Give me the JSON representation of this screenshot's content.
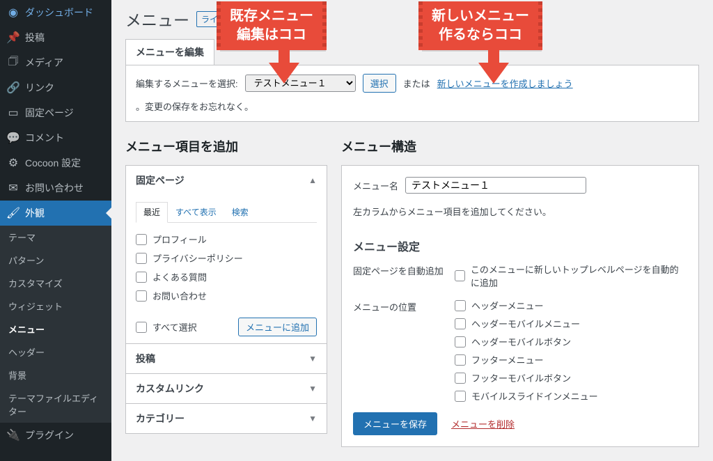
{
  "sidebar": {
    "items": [
      {
        "label": "ダッシュボード",
        "icon": "◉"
      },
      {
        "label": "投稿",
        "icon": "✎"
      },
      {
        "label": "メディア",
        "icon": "❐"
      },
      {
        "label": "リンク",
        "icon": "🔗"
      },
      {
        "label": "固定ページ",
        "icon": "▭"
      },
      {
        "label": "コメント",
        "icon": "💬"
      },
      {
        "label": "Cocoon 設定",
        "icon": "⚙"
      },
      {
        "label": "お問い合わせ",
        "icon": "✉"
      },
      {
        "label": "外観",
        "icon": "🖌"
      },
      {
        "label": "プラグイン",
        "icon": "🔌"
      }
    ],
    "appearance_sub": [
      "テーマ",
      "パターン",
      "カスタマイズ",
      "ウィジェット",
      "メニュー",
      "ヘッダー",
      "背景",
      "テーマファイルエディター"
    ]
  },
  "page": {
    "title": "メニュー",
    "tag": "ライ",
    "tab_edit": "メニューを編集"
  },
  "selector": {
    "label": "編集するメニューを選択:",
    "value": "テストメニュー１",
    "button": "選択",
    "or": "または",
    "create_link": "新しいメニューを作成しましょう",
    "suffix": "。変更の保存をお忘れなく。"
  },
  "callouts": {
    "edit_line1": "既存メニュー",
    "edit_line2": "編集はココ",
    "new_line1": "新しいメニュー",
    "new_line2": "作るならココ"
  },
  "add": {
    "title": "メニュー項目を追加",
    "pages": "固定ページ",
    "subtabs": {
      "recent": "最近",
      "all": "すべて表示",
      "search": "検索"
    },
    "items": [
      "プロフィール",
      "プライバシーポリシー",
      "よくある質問",
      "お問い合わせ"
    ],
    "select_all": "すべて選択",
    "add_btn": "メニューに追加",
    "posts": "投稿",
    "custom": "カスタムリンク",
    "categories": "カテゴリー"
  },
  "struct": {
    "title": "メニュー構造",
    "name_label": "メニュー名",
    "name_value": "テストメニュー１",
    "hint": "左カラムからメニュー項目を追加してください。",
    "settings_title": "メニュー設定",
    "auto_add_label": "固定ページを自動追加",
    "auto_add_opt": "このメニューに新しいトップレベルページを自動的に追加",
    "position_label": "メニューの位置",
    "positions": [
      "ヘッダーメニュー",
      "ヘッダーモバイルメニュー",
      "ヘッダーモバイルボタン",
      "フッターメニュー",
      "フッターモバイルボタン",
      "モバイルスライドインメニュー"
    ],
    "save": "メニューを保存",
    "delete": "メニューを削除"
  }
}
